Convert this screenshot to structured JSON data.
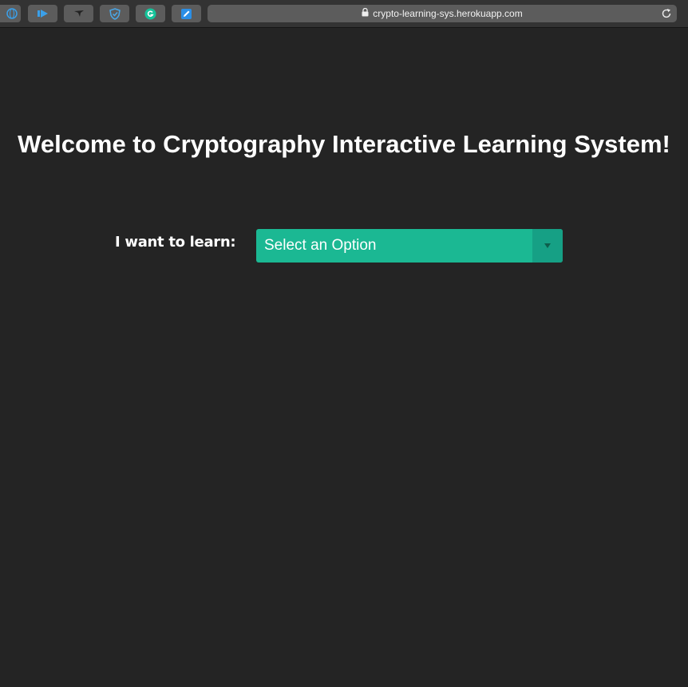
{
  "browser": {
    "url": "crypto-learning-sys.herokuapp.com",
    "extensions": [
      {
        "icon": "globe-icon"
      },
      {
        "icon": "screencast-icon"
      },
      {
        "icon": "bird-icon"
      },
      {
        "icon": "shield-icon"
      },
      {
        "icon": "grammarly-icon"
      },
      {
        "icon": "notes-icon"
      }
    ]
  },
  "page": {
    "title": "Welcome to Cryptography Interactive Learning System!",
    "learn_label": "I want to learn:",
    "select": {
      "placeholder": "Select an Option",
      "arrow_icon": "dropdown-arrow-icon"
    }
  },
  "colors": {
    "background": "#242424",
    "select_bg": "#1bb893",
    "select_arrow_bg": "#16a085"
  }
}
